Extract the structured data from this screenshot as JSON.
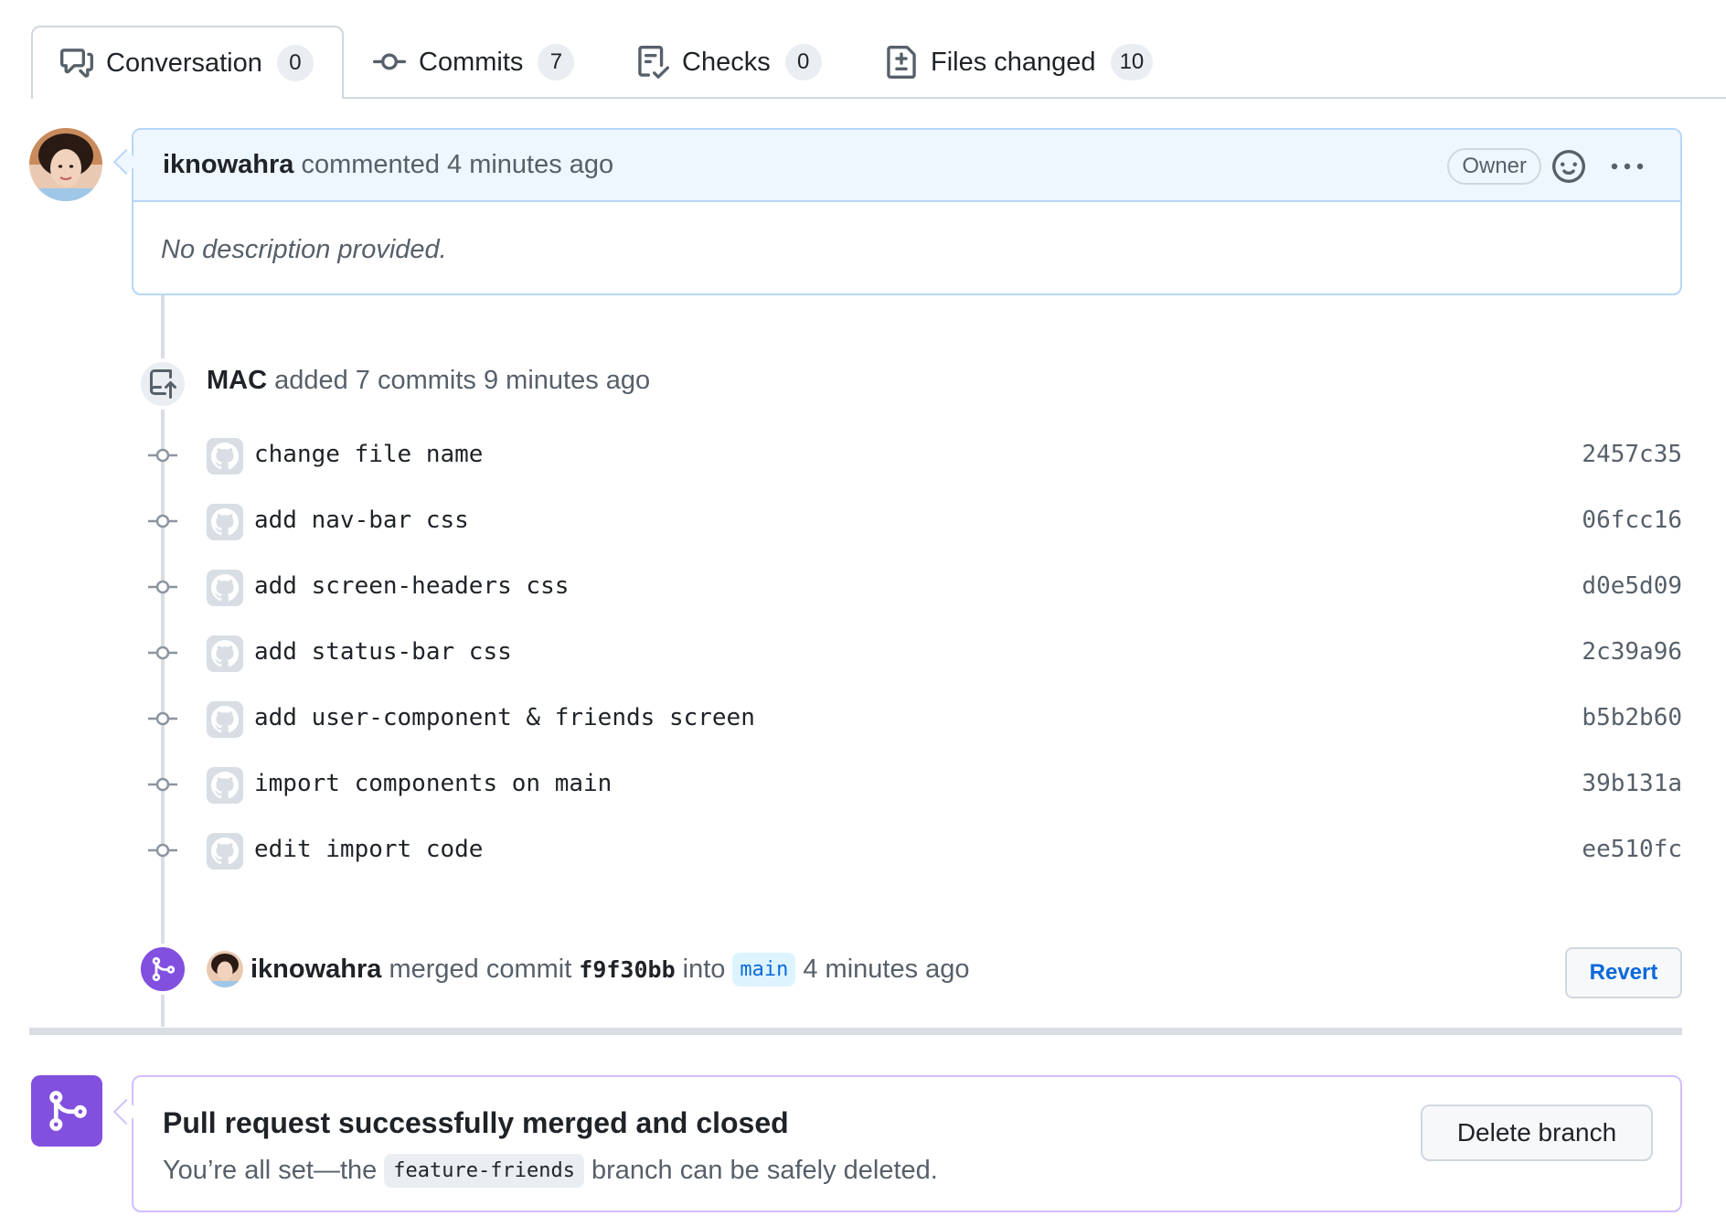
{
  "tabs": [
    {
      "label": "Conversation",
      "count": "0",
      "icon": "comment-discussion-icon"
    },
    {
      "label": "Commits",
      "count": "7",
      "icon": "git-commit-icon"
    },
    {
      "label": "Checks",
      "count": "0",
      "icon": "checklist-icon"
    },
    {
      "label": "Files changed",
      "count": "10",
      "icon": "file-diff-icon"
    }
  ],
  "comment": {
    "author": "iknowahra",
    "action": "commented 4 minutes ago",
    "badge": "Owner",
    "body": "No description provided."
  },
  "push_event": {
    "author": "MAC",
    "text": " added 7 commits 9 minutes ago"
  },
  "commits": [
    {
      "message": "change file name",
      "sha": "2457c35"
    },
    {
      "message": "add nav-bar css",
      "sha": "06fcc16"
    },
    {
      "message": "add screen-headers css",
      "sha": "d0e5d09"
    },
    {
      "message": "add status-bar css",
      "sha": "2c39a96"
    },
    {
      "message": "add user-component & friends screen",
      "sha": "b5b2b60"
    },
    {
      "message": "import components on main",
      "sha": "39b131a"
    },
    {
      "message": "edit import code",
      "sha": "ee510fc"
    }
  ],
  "merge_event": {
    "author": "iknowahra",
    "text1": "merged commit",
    "sha": "f9f30bb",
    "text2": "into",
    "branch": "main",
    "time": "4 minutes ago",
    "revert_label": "Revert"
  },
  "merged_box": {
    "title": "Pull request successfully merged and closed",
    "sub_pre": "You’re all set—the",
    "branch": "feature-friends",
    "sub_post": "branch can be safely deleted.",
    "delete_label": "Delete branch"
  },
  "colors": {
    "accent_blue": "#0969da",
    "merged_purple": "#8250df"
  }
}
